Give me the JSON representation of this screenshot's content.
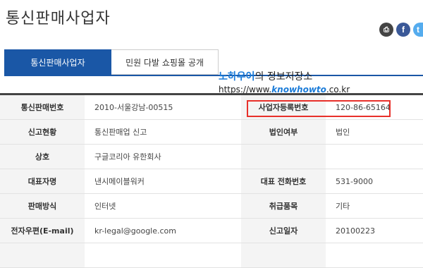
{
  "page": {
    "title": "통신판매사업자"
  },
  "share": {
    "print_icon": "⎙",
    "facebook_icon": "f",
    "twitter_icon": "t"
  },
  "tabs": [
    {
      "label": "통신판매사업자",
      "active": true
    },
    {
      "label": "민원 다발 쇼핑몰 공개",
      "active": false
    }
  ],
  "watermark": {
    "line1_accent": "노하우어",
    "line1_rest": "의 정보저장소",
    "url_prefix": "https://www.",
    "url_know": "know",
    "url_howto": "howto",
    "url_suffix": ".co.kr"
  },
  "rows": [
    {
      "label1": "통신판매번호",
      "value1": "2010-서울강남-00515",
      "label2": "사업자등록번호",
      "value2": "120-86-65164"
    },
    {
      "label1": "신고현황",
      "value1": "통신판매업 신고",
      "label2": "법인여부",
      "value2": "법인"
    },
    {
      "label1": "상호",
      "value1": "구글코리아 유한회사",
      "label2": "",
      "value2": ""
    },
    {
      "label1": "대표자명",
      "value1": "낸시메이블워커",
      "label2": "대표 전화번호",
      "value2": "531-9000"
    },
    {
      "label1": "판매방식",
      "value1": "인터넷",
      "label2": "취급품목",
      "value2": "기타"
    },
    {
      "label1": "전자우편(E-mail)",
      "value1": "kr-legal@google.com",
      "label2": "신고일자",
      "value2": "20100223"
    },
    {
      "label1": "",
      "value1": "",
      "label2": "",
      "value2": ""
    }
  ],
  "colors": {
    "tab_active": "#1a57a6",
    "highlight": "#e8302a",
    "watermark_accent": "#1a7bd8"
  }
}
